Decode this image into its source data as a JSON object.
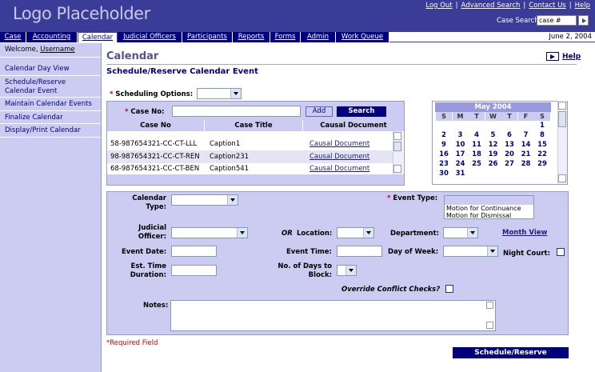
{
  "header": {
    "logo": "Logo Placeholder",
    "links": [
      "Log Out",
      "Advanced Search",
      "Contact Us",
      "Help"
    ],
    "case_search_label": "Case Search",
    "case_search_value": "case #"
  },
  "menu": [
    {
      "label": "Case",
      "active": false
    },
    {
      "label": "Accounting",
      "active": false
    },
    {
      "label": "Calendar",
      "active": true
    },
    {
      "label": "Judicial Officers",
      "active": false
    },
    {
      "label": "Participants",
      "active": false
    },
    {
      "label": "Reports",
      "active": false
    },
    {
      "label": "Forms",
      "active": false
    },
    {
      "label": "Admin",
      "active": false
    },
    {
      "label": "Work Queue",
      "active": false
    }
  ],
  "date": "June 2, 2004",
  "sidebar": {
    "welcome": "Welcome,",
    "username": "Username",
    "items": [
      "Calendar Day View",
      "Schedule/Reserve Calendar Event",
      "Maintain Calendar Events",
      "Finalize Calendar",
      "Display/Print Calendar"
    ]
  },
  "page": {
    "title": "Calendar",
    "section": "Schedule/Reserve Calendar Event",
    "help": "Help"
  },
  "scheduling": {
    "options_label": "Scheduling Options:",
    "required_mark": "*"
  },
  "case_search": {
    "label": "Case No:",
    "add": "Add",
    "search": "Search",
    "columns": [
      "Case No",
      "Case Title",
      "Causal Document"
    ],
    "rows": [
      {
        "case_no": "58-987654321-CC-CT-LLL",
        "title": "Caption1",
        "doc": "Causal Document"
      },
      {
        "case_no": "98-987654321-CC-CT-REN",
        "title": "Caption231",
        "doc": "Causal Document"
      },
      {
        "case_no": "68-987654321-CC-CT-BEN",
        "title": "Caption541",
        "doc": "Causal Document"
      }
    ]
  },
  "calendar": {
    "month": "May 2004",
    "dow": [
      "S",
      "M",
      "T",
      "W",
      "T",
      "F",
      "S"
    ],
    "weeks": [
      [
        "",
        "",
        "",
        "",
        "",
        "",
        "1"
      ],
      [
        "2",
        "3",
        "4",
        "5",
        "6",
        "7",
        "8"
      ],
      [
        "9",
        "10",
        "11",
        "12",
        "13",
        "14",
        "15"
      ],
      [
        "16",
        "17",
        "18",
        "19",
        "20",
        "21",
        "22"
      ],
      [
        "23",
        "24",
        "25",
        "26",
        "27",
        "28",
        "29"
      ],
      [
        "30",
        "31",
        "",
        "",
        "",
        "",
        ""
      ]
    ]
  },
  "event": {
    "calendar_type": "Calendar Type:",
    "event_type": "Event Type:",
    "event_type_options": [
      "Motion for Continuance",
      "Motion for Dismissal"
    ],
    "judicial_officer": "Judicial Officer:",
    "or": "OR",
    "location": "Location:",
    "department": "Department:",
    "month_view": "Month View",
    "event_date": "Event Date:",
    "event_time": "Event Time:",
    "day_of_week": "Day of Week:",
    "night_court": "Night Court:",
    "est_time": "Est. Time Duration:",
    "days_to_block": "No. of Days to Block:",
    "override": "Override Conflict Checks?",
    "notes": "Notes:"
  },
  "footer": {
    "required_note": "*Required Field",
    "submit": "Schedule/Reserve"
  }
}
